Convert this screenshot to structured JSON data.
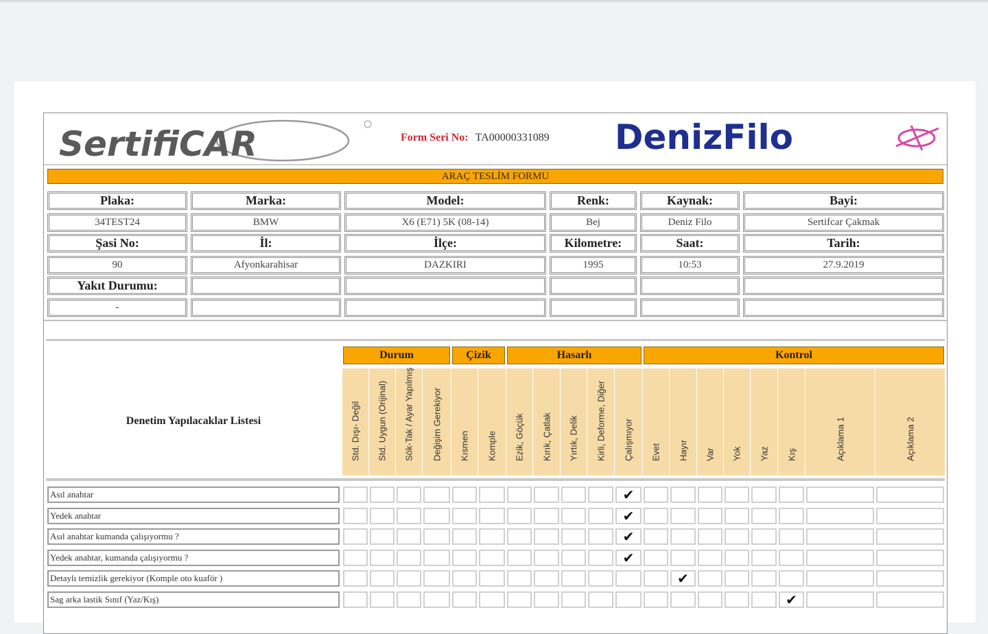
{
  "header": {
    "left_logo": "SertifiCAR",
    "serial_label": "Form Seri No:",
    "serial_value": "TA00000331089",
    "right_logo": "DenizFilo"
  },
  "form_title": "ARAÇ TESLİM FORMU",
  "info_rows": [
    [
      "Plaka:",
      "Marka:",
      "Model:",
      "Renk:",
      "Kaynak:",
      "Bayi:"
    ],
    [
      "34TEST24",
      "BMW",
      "X6 (E71) 5K (08-14)",
      "Bej",
      "Deniz Filo",
      "Sertifcar Çakmak"
    ],
    [
      "Şasi No:",
      "İl:",
      "İlçe:",
      "Kilometre:",
      "Saat:",
      "Tarih:"
    ],
    [
      "90",
      "Afyonkarahisar",
      "DAZKIRI",
      "1995",
      "10:53",
      "27.9.2019"
    ],
    [
      "Yakıt Durumu:",
      "",
      "",
      "",
      "",
      ""
    ],
    [
      "-",
      "",
      "",
      "",
      "",
      ""
    ]
  ],
  "checklist": {
    "title": "Denetim Yapılacaklar Listesi",
    "groups": [
      "Durum",
      "Çizik",
      "Hasarlı",
      "Kontrol"
    ],
    "columns": [
      "Std. Dışı- Değil",
      "Std. Uygun (Orijinal)",
      "Sök-Tak / Ayar Yapılmış",
      "Değişim Gerekiyor",
      "Kısmen",
      "Komple",
      "Ezik, Göçük",
      "Kırık, Çatlak",
      "Yırtık, Delik",
      "Kirli, Deforme, Diğer",
      "Çalışmıyor",
      "Evet",
      "Hayır",
      "Var",
      "Yok",
      "Yaz",
      "Kış",
      "Açıklama 1",
      "Açıklama 2"
    ],
    "check_mark": "✔",
    "rows": [
      {
        "label": "Asıl anahtar",
        "checked": 10
      },
      {
        "label": "Yedek anahtar",
        "checked": 10
      },
      {
        "label": "Asıl anahtar kumanda çalışıyormu ?",
        "checked": 10
      },
      {
        "label": "Yedek anahtar, kumanda çalışıyormu ?",
        "checked": 10
      },
      {
        "label": "Detaylı temizlik gerekiyor (Komple oto kuaför )",
        "checked": 12
      },
      {
        "label": "Sag arka lastik Sınıf (Yaz/Kış)",
        "checked": 16
      }
    ]
  }
}
